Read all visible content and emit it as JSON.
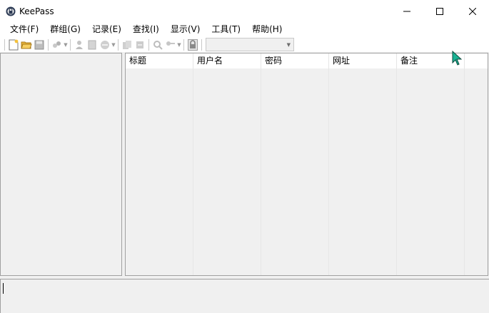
{
  "window": {
    "title": "KeePass"
  },
  "title_controls": {
    "minimize": "minimize",
    "maximize": "maximize",
    "close": "close"
  },
  "menu": [
    {
      "label": "文件(F)"
    },
    {
      "label": "群组(G)"
    },
    {
      "label": "记录(E)"
    },
    {
      "label": "查找(I)"
    },
    {
      "label": "显示(V)"
    },
    {
      "label": "工具(T)"
    },
    {
      "label": "帮助(H)"
    }
  ],
  "toolbar": {
    "icons": [
      "new-database-icon",
      "open-folder-icon",
      "save-icon",
      "sync-icon",
      "add-entry-icon",
      "edit-entry-icon",
      "delete-entry-icon",
      "copy-username-icon",
      "copy-password-icon",
      "find-icon",
      "key-icon",
      "lock-icon"
    ],
    "quick_search_value": ""
  },
  "list": {
    "columns": [
      "标题",
      "用户名",
      "密码",
      "网址",
      "备注"
    ],
    "rows": []
  },
  "colors": {
    "window_bg": "#f0f0f0",
    "border": "#a0a0a0",
    "cursor": "#1ab394"
  }
}
